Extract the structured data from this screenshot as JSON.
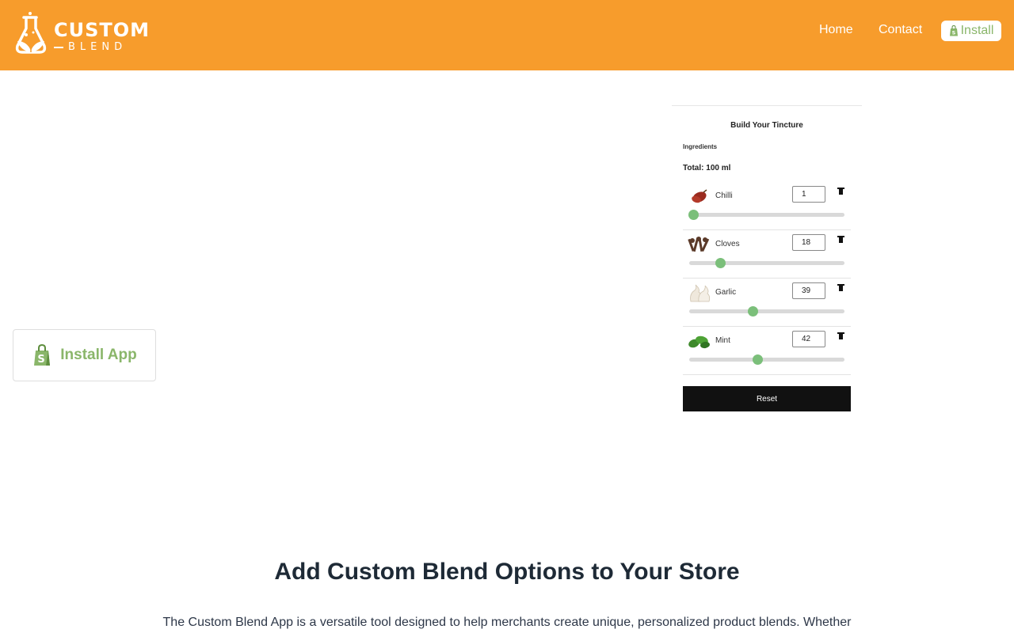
{
  "header": {
    "logo": {
      "word1": "CUSTOM",
      "word2": "BLEND"
    },
    "nav": {
      "home": "Home",
      "contact": "Contact",
      "install": "Install"
    }
  },
  "install_card": {
    "label": "Install App"
  },
  "preview": {
    "title": "Build Your Tincture",
    "ingredients_label": "Ingredients",
    "total": "Total: 100 ml",
    "items": [
      {
        "name": "Chilli",
        "value": "1",
        "level": 0.01
      },
      {
        "name": "Cloves",
        "value": "18",
        "level": 0.18
      },
      {
        "name": "Garlic",
        "value": "39",
        "level": 0.39
      },
      {
        "name": "Mint",
        "value": "42",
        "level": 0.42
      }
    ],
    "reset_label": "Reset"
  },
  "main": {
    "heading": "Add Custom Blend Options to Your Store",
    "description": "The Custom Blend App is a versatile tool designed to help merchants create unique, personalized product blends. Whether"
  },
  "colors": {
    "header_bg": "#f79c2c",
    "accent_green": "#8ab66a",
    "slider_green": "#7bbf7a"
  },
  "icons": [
    "logo-icon",
    "shopify-bag-icon",
    "trash-icon"
  ]
}
